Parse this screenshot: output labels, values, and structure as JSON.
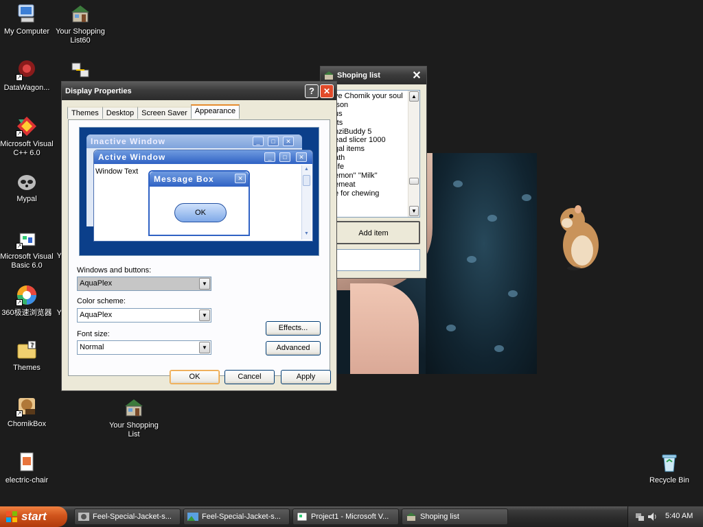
{
  "desktop": {
    "icons": [
      {
        "label": "My Computer"
      },
      {
        "label": "Your Shopping List60"
      },
      {
        "label": "DataWagon..."
      },
      {
        "label": "Microsoft Visual C++ 6.0"
      },
      {
        "label": "Mypal"
      },
      {
        "label": "Microsoft Visual Basic 6.0"
      },
      {
        "label": "360极速浏览器"
      },
      {
        "label": "Themes"
      },
      {
        "label": "ChomikBox"
      },
      {
        "label": "Your Shopping List"
      },
      {
        "label": "electric-chair"
      },
      {
        "label": "Recycle Bin"
      }
    ],
    "partial_label": "Y"
  },
  "display_properties": {
    "title": "Display Properties",
    "help_btn": "?",
    "close_btn": "✕",
    "tabs": [
      "Themes",
      "Desktop",
      "Screen Saver",
      "Appearance"
    ],
    "active_tab": "Appearance",
    "preview": {
      "inactive_title": "Inactive Window",
      "active_title": "Active Window",
      "window_text": "Window Text",
      "message_title": "Message Box",
      "ok": "OK"
    },
    "windows_buttons_label": "Windows and buttons:",
    "windows_buttons_value": "AquaPlex",
    "color_scheme_label": "Color scheme:",
    "color_scheme_value": "AquaPlex",
    "font_size_label": "Font size:",
    "font_size_value": "Normal",
    "effects_btn": "Effects...",
    "advanced_btn": "Advanced",
    "ok_btn": "OK",
    "cancel_btn": "Cancel",
    "apply_btn": "Apply"
  },
  "shopping_list": {
    "title": "Shoping list",
    "close_btn": "✕",
    "items": [
      "ve Chomik your soul",
      "ison",
      "us",
      "rts",
      "nziBuddy 5",
      "ead slicer 1000",
      "gal items",
      "ath",
      "life",
      "emon'' ''Milk''",
      "emeat",
      "e for chewing"
    ],
    "add_item_btn": "Add item",
    "input_value": ""
  },
  "taskbar": {
    "start_label": "start",
    "tasks": [
      {
        "label": "Feel-Special-Jacket-s..."
      },
      {
        "label": "Feel-Special-Jacket-s..."
      },
      {
        "label": "Project1 - Microsoft V..."
      },
      {
        "label": "Shoping list"
      }
    ],
    "clock": "5:40 AM"
  },
  "colors": {
    "accent": "#0b3f8a",
    "start": "#d0541c",
    "close": "#e04a2a"
  }
}
